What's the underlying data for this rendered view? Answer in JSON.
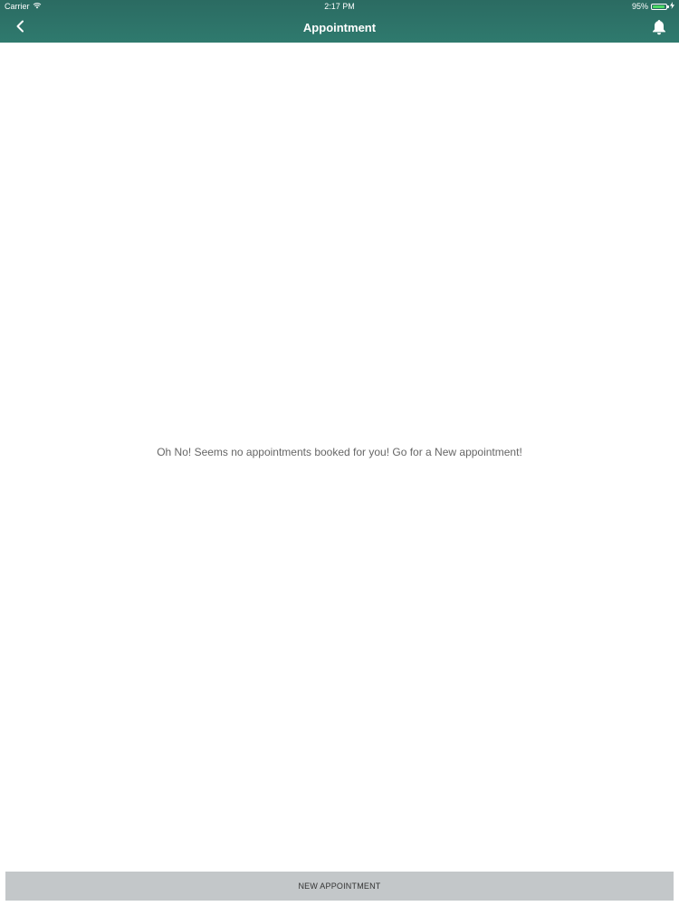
{
  "status_bar": {
    "carrier": "Carrier",
    "time": "2:17 PM",
    "battery_percent_label": "95%",
    "battery_level": 0.95,
    "wifi_icon": "wifi-icon",
    "battery_icon": "battery-icon",
    "charging_icon": "charging-bolt-icon"
  },
  "nav_bar": {
    "title": "Appointment",
    "back_icon": "chevron-left-icon",
    "bell_icon": "bell-icon"
  },
  "main": {
    "empty_message": "Oh No! Seems no appointments booked for you! Go for a New appointment!"
  },
  "footer": {
    "new_appointment_label": "NEW APPOINTMENT"
  },
  "colors": {
    "header_bg": "#2f7a6e",
    "button_bg": "#c3c7c9",
    "battery_fill": "#4cd964",
    "message_text": "#666666"
  }
}
